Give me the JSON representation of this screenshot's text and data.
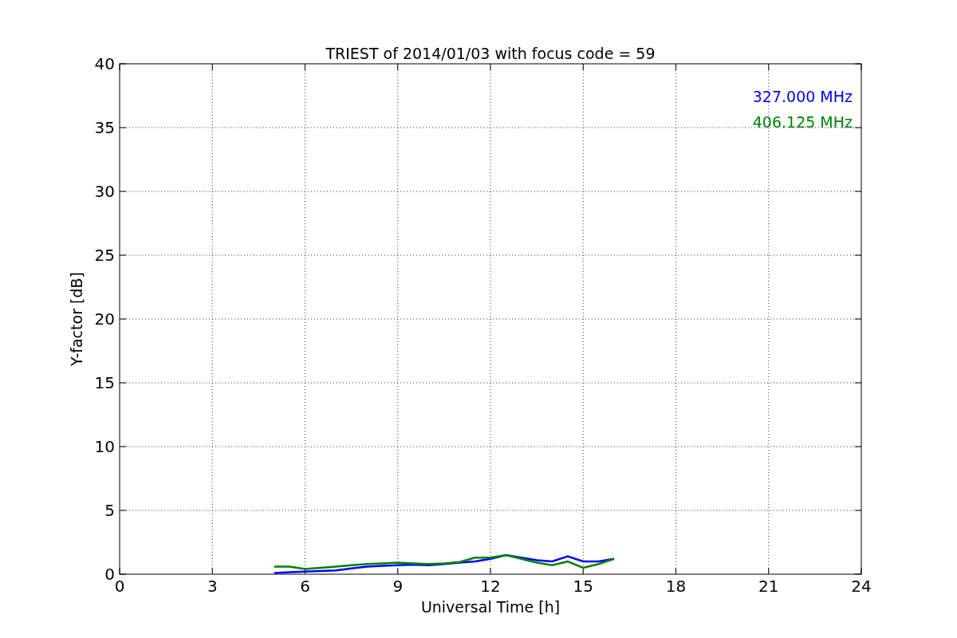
{
  "chart_data": {
    "type": "line",
    "title": "TRIEST of 2014/01/03 with focus code = 59",
    "xlabel": "Universal Time [h]",
    "ylabel": "Y-factor [dB]",
    "x": [
      5,
      5.5,
      6,
      6.5,
      7,
      7.5,
      8,
      8.5,
      9,
      9.5,
      10,
      10.5,
      11,
      11.5,
      12,
      12.5,
      13,
      13.5,
      14,
      14.5,
      15,
      15.5,
      16
    ],
    "series": [
      {
        "name": "327.000 MHz",
        "color": "#0000ff",
        "values": [
          0.1,
          0.15,
          0.2,
          0.25,
          0.3,
          0.45,
          0.6,
          0.65,
          0.7,
          0.75,
          0.7,
          0.8,
          0.9,
          1.0,
          1.2,
          1.5,
          1.3,
          1.1,
          1.0,
          1.4,
          1.0,
          1.0,
          1.2
        ]
      },
      {
        "name": "406.125 MHz",
        "color": "#008000",
        "values": [
          0.6,
          0.6,
          0.4,
          0.5,
          0.6,
          0.7,
          0.8,
          0.85,
          0.9,
          0.85,
          0.8,
          0.85,
          0.95,
          1.3,
          1.3,
          1.5,
          1.2,
          0.9,
          0.7,
          1.0,
          0.5,
          0.8,
          1.2
        ]
      }
    ],
    "grid": true,
    "xlim": [
      0,
      24
    ],
    "ylim": [
      0,
      40
    ],
    "xticks": [
      0,
      3,
      6,
      9,
      12,
      15,
      18,
      21,
      24
    ],
    "yticks": [
      0,
      5,
      10,
      15,
      20,
      25,
      30,
      35,
      40
    ]
  }
}
